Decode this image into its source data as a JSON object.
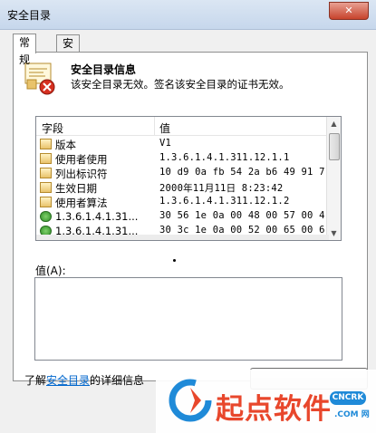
{
  "window": {
    "title": "安全目录",
    "close_label": "✕"
  },
  "tabs": [
    {
      "label": "常规",
      "active": true
    },
    {
      "label": "安全目录",
      "active": false
    }
  ],
  "info": {
    "icon": "certificate-error-icon",
    "title": "安全目录信息",
    "message": "该安全目录无效。签名该安全目录的证书无效。"
  },
  "list": {
    "columns": [
      "字段",
      "值"
    ],
    "rows": [
      {
        "field": "版本",
        "value": "V1",
        "icon": "field-icon"
      },
      {
        "field": "使用者使用",
        "value": "1.3.6.1.4.1.311.12.1.1",
        "icon": "field-icon"
      },
      {
        "field": "列出标识符",
        "value": "10 d9 0a fb 54 2a b6 49 91 7...",
        "icon": "field-icon"
      },
      {
        "field": "生效日期",
        "value": "2000年11月11日 8:23:42",
        "icon": "field-icon"
      },
      {
        "field": "使用者算法",
        "value": "1.3.6.1.4.1.311.12.1.2",
        "icon": "field-icon"
      },
      {
        "field": "1.3.6.1.4.1.31...",
        "value": "30 56 1e 0a 00 48 00 57 00 4...",
        "icon": "extension-icon"
      },
      {
        "field": "1.3.6.1.4.1.31...",
        "value": "30 3c 1e 0a 00 52 00 65 00 6...",
        "icon": "extension-icon"
      }
    ]
  },
  "value_section": {
    "label": "值(A):",
    "value": ""
  },
  "footer": {
    "learn_prefix": "了解",
    "learn_link": "安全目录",
    "learn_suffix": "的详细信息"
  },
  "watermark": {
    "text": "起点软件",
    "badge": "CNCRK",
    "domain": ".COM 网"
  }
}
